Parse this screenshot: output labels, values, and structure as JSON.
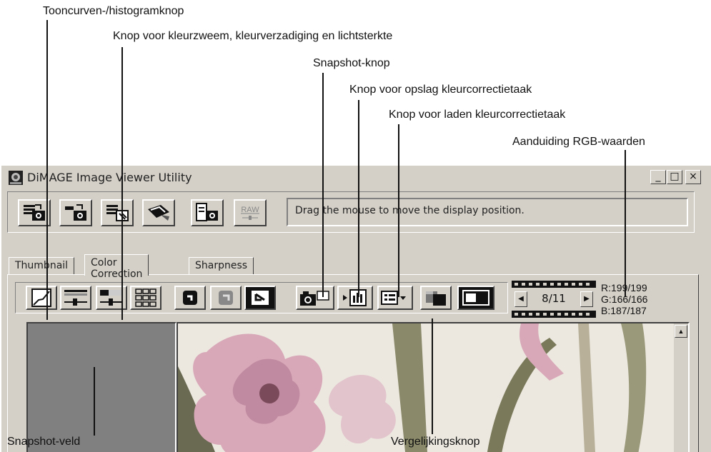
{
  "callouts": {
    "tone_curve": "Tooncurven-/histogramknop",
    "hue_saturation": "Knop voor kleurzweem, kleurverzadiging en lichtsterkte",
    "snapshot": "Snapshot-knop",
    "save_job": "Knop voor opslag kleurcorrectietaak",
    "load_job": "Knop voor laden kleurcorrectietaak",
    "rgb_values": "Aanduiding RGB-waarden",
    "snapshot_field": "Snapshot-veld",
    "compare": "Vergelijkingsknop"
  },
  "window": {
    "title": "DiMAGE Image Viewer Utility",
    "minimize": "_",
    "maximize": "□",
    "close": "×"
  },
  "toolbar": {
    "status_message": "Drag the mouse to move the display position.",
    "raw_label": "RAW"
  },
  "tabs": [
    "Thumbnail",
    "Color Correction",
    "Sharpness"
  ],
  "frame_counter": "8/11",
  "rgb": {
    "r": "R:199/199",
    "g": "G:166/166",
    "b": "B:187/187"
  },
  "colors": {
    "window_bg": "#d4d0c8",
    "snapshot_field": "#808080",
    "image_bg": "#ece8e0",
    "flower_pink": "#d8a8b8"
  },
  "icons": [
    "folder-image-icon",
    "open-image-icon",
    "save-image-icon",
    "print-icon",
    "camera-file-icon",
    "raw-icon",
    "tone-curve-icon",
    "color-balance-icon",
    "brightness-icon",
    "variations-icon",
    "undo-icon",
    "reset-icon",
    "revert-icon",
    "camera-icon",
    "save-job-icon",
    "load-job-icon",
    "compare-icon",
    "split-view-icon"
  ]
}
